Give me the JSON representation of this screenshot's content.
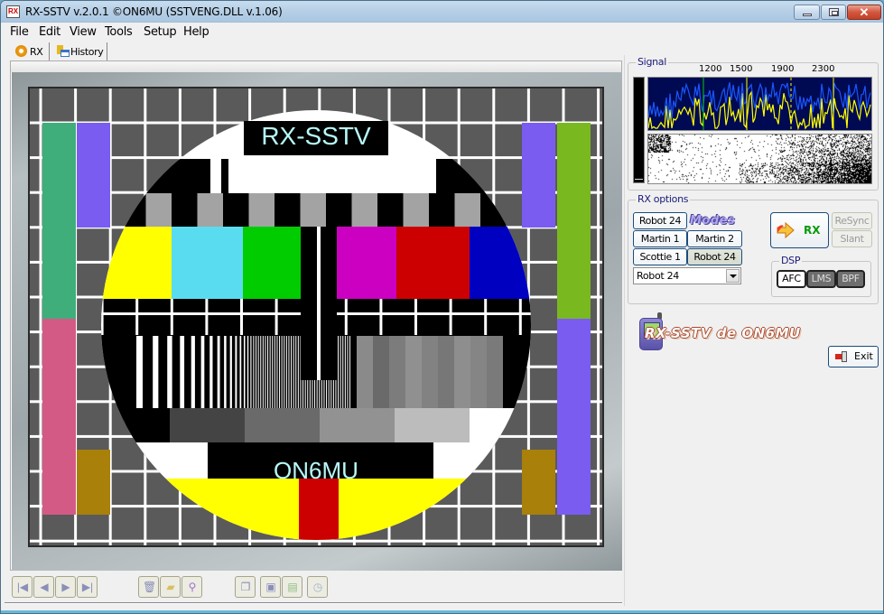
{
  "window": {
    "title": "RX-SSTV v.2.0.1 ©ON6MU (SSTVENG.DLL v.1.06)",
    "app_icon_text": "RX",
    "controls": {
      "minimize": "minimize",
      "maximize": "maximize",
      "close": "✕"
    }
  },
  "menu": [
    "File",
    "Edit",
    "View",
    "Tools",
    "Setup",
    "Help"
  ],
  "tabs": [
    {
      "label": "RX",
      "icon": "gear-icon",
      "active": true
    },
    {
      "label": "History",
      "icon": "history-icon",
      "active": false
    }
  ],
  "image": {
    "top_caption": "RX-SSTV",
    "bottom_caption": "ON6MU",
    "colors": {
      "yellow": "#ffff00",
      "cyan": "#5adcf0",
      "green": "#00cc00",
      "magenta": "#cc00c0",
      "red": "#cc0000",
      "blue": "#0000c0",
      "grid_gray": "#5a5a5a",
      "caption_text": "#b8f8f8",
      "left_green": "#3fae7a",
      "left_pink": "#d45a86",
      "purple": "#7a5cf0",
      "right_green": "#7ab820",
      "ochre": "#a8800a"
    }
  },
  "toolbar": {
    "nav": [
      {
        "name": "first-image-button",
        "icon": "first-icon",
        "glyph": "|◀"
      },
      {
        "name": "prev-image-button",
        "icon": "prev-icon",
        "glyph": "◀"
      },
      {
        "name": "next-image-button",
        "icon": "next-icon",
        "glyph": "▶"
      },
      {
        "name": "last-image-button",
        "icon": "last-icon",
        "glyph": "▶|"
      }
    ],
    "file": [
      {
        "name": "delete-button",
        "icon": "trash-icon",
        "glyph": "🗑"
      },
      {
        "name": "open-folder-button",
        "icon": "folder-icon",
        "glyph": "▰"
      },
      {
        "name": "zoom-button",
        "icon": "magnifier-icon",
        "glyph": "⚲"
      }
    ],
    "save": [
      {
        "name": "copy-button",
        "icon": "copy-icon",
        "glyph": "❐"
      },
      {
        "name": "save-button",
        "icon": "floppy-icon",
        "glyph": "▣"
      },
      {
        "name": "save-all-button",
        "icon": "save-multiple-icon",
        "glyph": "▤"
      },
      {
        "name": "auto-save-button",
        "icon": "auto-save-icon",
        "glyph": "◷"
      }
    ]
  },
  "signal": {
    "legend": "Signal",
    "freq_labels": [
      "1200",
      "1500",
      "1900",
      "2300"
    ],
    "marker_colors": {
      "sync": "#00cc00",
      "black": "#ffff00",
      "white": "#ffff00"
    },
    "trace_colors": {
      "primary": "#1a56ff",
      "secondary": "#ffff00"
    },
    "background": "#000a52"
  },
  "rx_options": {
    "legend": "RX options",
    "modes_logo": "Modes",
    "mode_buttons": [
      {
        "label": "Robot 24",
        "active": false
      },
      {
        "label": "Martin 1",
        "active": false
      },
      {
        "label": "Martin 2",
        "active": false
      },
      {
        "label": "Scottie 1",
        "active": false
      },
      {
        "label": "Robot 24",
        "active": true
      }
    ],
    "mode_select": {
      "value": "Robot 24"
    },
    "rx_button": "RX",
    "resync_button": "ReSync",
    "slant_button": "Slant",
    "dsp": {
      "legend": "DSP",
      "buttons": [
        {
          "label": "AFC",
          "on": true
        },
        {
          "label": "LMS",
          "on": false
        },
        {
          "label": "BPF",
          "on": false
        }
      ]
    }
  },
  "branding": {
    "text": "RX-SSTV de ON6MU"
  },
  "exit_button": "Exit"
}
